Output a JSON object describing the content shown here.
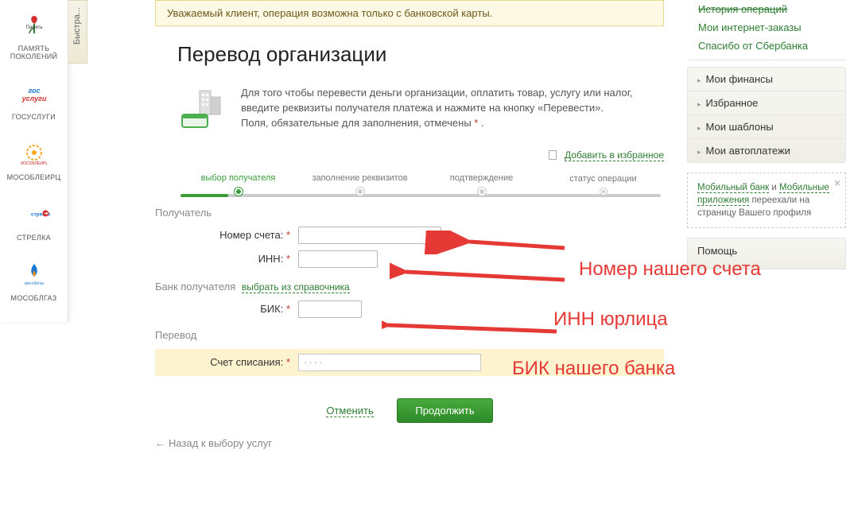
{
  "sidebar": {
    "quick_label": "Быстра...",
    "items": [
      {
        "label": "ПАМЯТЬ",
        "sublabel": "ПОКОЛЕНИЙ",
        "icon": "flower"
      },
      {
        "label": "ГОСУСЛУГИ",
        "icon": "gosuslugi"
      },
      {
        "label": "МосОблЕИРЦ",
        "icon": "mosobleirc"
      },
      {
        "label": "СТРЕЛКА",
        "icon": "strelka"
      },
      {
        "label": "Мособлгаз",
        "icon": "gas"
      }
    ]
  },
  "warning": "Уважаемый клиент, операция возможна только с банковской карты.",
  "page_title": "Перевод организации",
  "instructions": {
    "line1": "Для того чтобы перевести деньги организации, оплатить товар, услугу или налог, введите реквизиты получателя платежа и нажмите на кнопку «Перевести».",
    "line2": "Поля, обязательные для заполнения, отмечены "
  },
  "favorites_link": "Добавить в избранное",
  "steps": [
    "выбор получателя",
    "заполнение реквизитов",
    "подтверждение",
    "статус операции"
  ],
  "sections": {
    "recipient": "Получатель",
    "bank": "Банк получателя",
    "bank_link": "выбрать из справочника",
    "transfer": "Перевод"
  },
  "fields": {
    "account": "Номер счета:",
    "inn": "ИНН:",
    "bik": "БИК:",
    "debit": "Счет списания:"
  },
  "debit_masked": "····",
  "buttons": {
    "cancel": "Отменить",
    "continue": "Продолжить"
  },
  "back_link": "Назад к выбору услуг",
  "right": {
    "history": "История операций",
    "orders": "Мои интернет-заказы",
    "thanks": "Спасибо от Сбербанка",
    "menu": [
      "Мои финансы",
      "Избранное",
      "Мои шаблоны",
      "Мои автоплатежи"
    ],
    "info_mobile": "Мобильный банк",
    "info_and": " и ",
    "info_apps": "Мобильные приложения",
    "info_rest": " переехали на страницу Вашего профиля",
    "help": "Помощь"
  },
  "annotations": {
    "a1": "Номер  нашего счета",
    "a2": "ИНН юрлица",
    "a3": "БИК нашего банка"
  }
}
